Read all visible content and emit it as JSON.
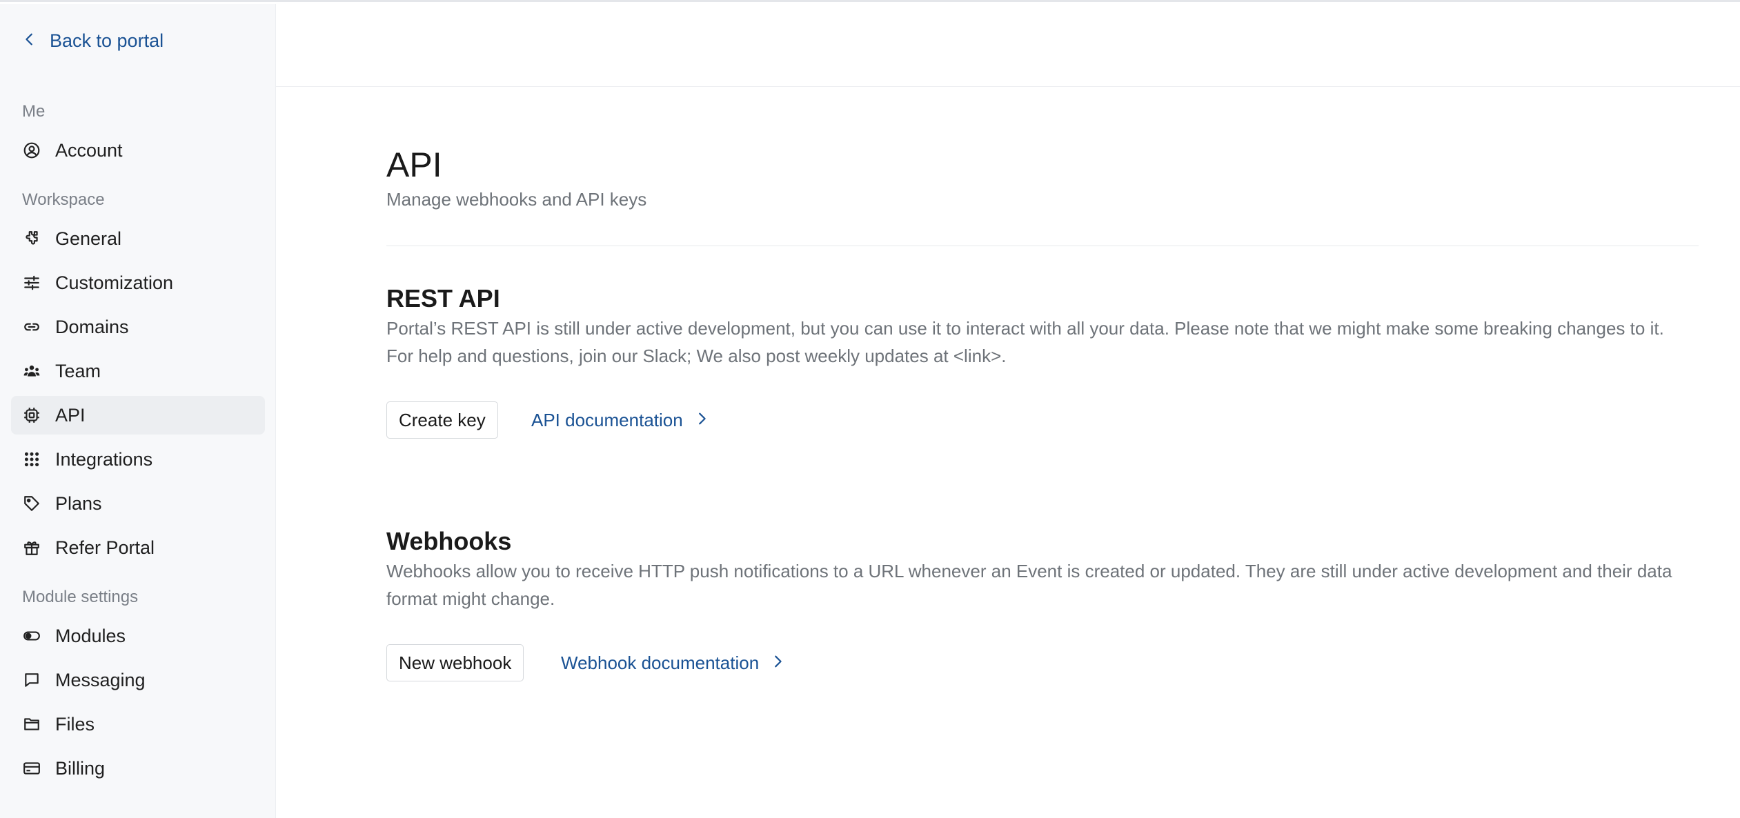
{
  "sidebar": {
    "back_label": "Back to portal",
    "sections": {
      "me": "Me",
      "workspace": "Workspace",
      "module_settings": "Module settings"
    },
    "items": {
      "account": "Account",
      "general": "General",
      "customization": "Customization",
      "domains": "Domains",
      "team": "Team",
      "api": "API",
      "integrations": "Integrations",
      "plans": "Plans",
      "refer_portal": "Refer Portal",
      "modules": "Modules",
      "messaging": "Messaging",
      "files": "Files",
      "billing": "Billing"
    },
    "active_item": "API"
  },
  "main": {
    "title": "API",
    "subtitle": "Manage webhooks and API keys",
    "rest": {
      "title": "REST API",
      "description": "Portal’s REST API is still under active development, but you can use it to interact with all your data. Please note that we might make some breaking changes to it. For help and questions, join our Slack; We also post weekly updates at <link>.",
      "button_label": "Create key",
      "doc_link_label": "API documentation"
    },
    "webhooks": {
      "title": "Webhooks",
      "description": "Webhooks allow you to receive HTTP push notifications to a URL whenever an Event is created or updated. They are still under active development and their data format might change.",
      "button_label": "New webhook",
      "doc_link_label": "Webhook documentation"
    }
  },
  "colors": {
    "link": "#1a5294",
    "sidebar_bg": "#f7f8fa",
    "active_bg": "#eceef1",
    "muted_text": "#6e7379"
  },
  "icons": {
    "back": "chevron-left-icon",
    "account": "user-circle-icon",
    "general": "puzzle-icon",
    "customization": "sliders-icon",
    "domains": "link-icon",
    "team": "users-icon",
    "api": "chip-icon",
    "integrations": "grid-dots-icon",
    "plans": "tag-icon",
    "refer_portal": "gift-icon",
    "modules": "toggle-icon",
    "messaging": "message-icon",
    "files": "folder-icon",
    "billing": "credit-card-icon",
    "doc_link": "chevron-right-icon"
  }
}
